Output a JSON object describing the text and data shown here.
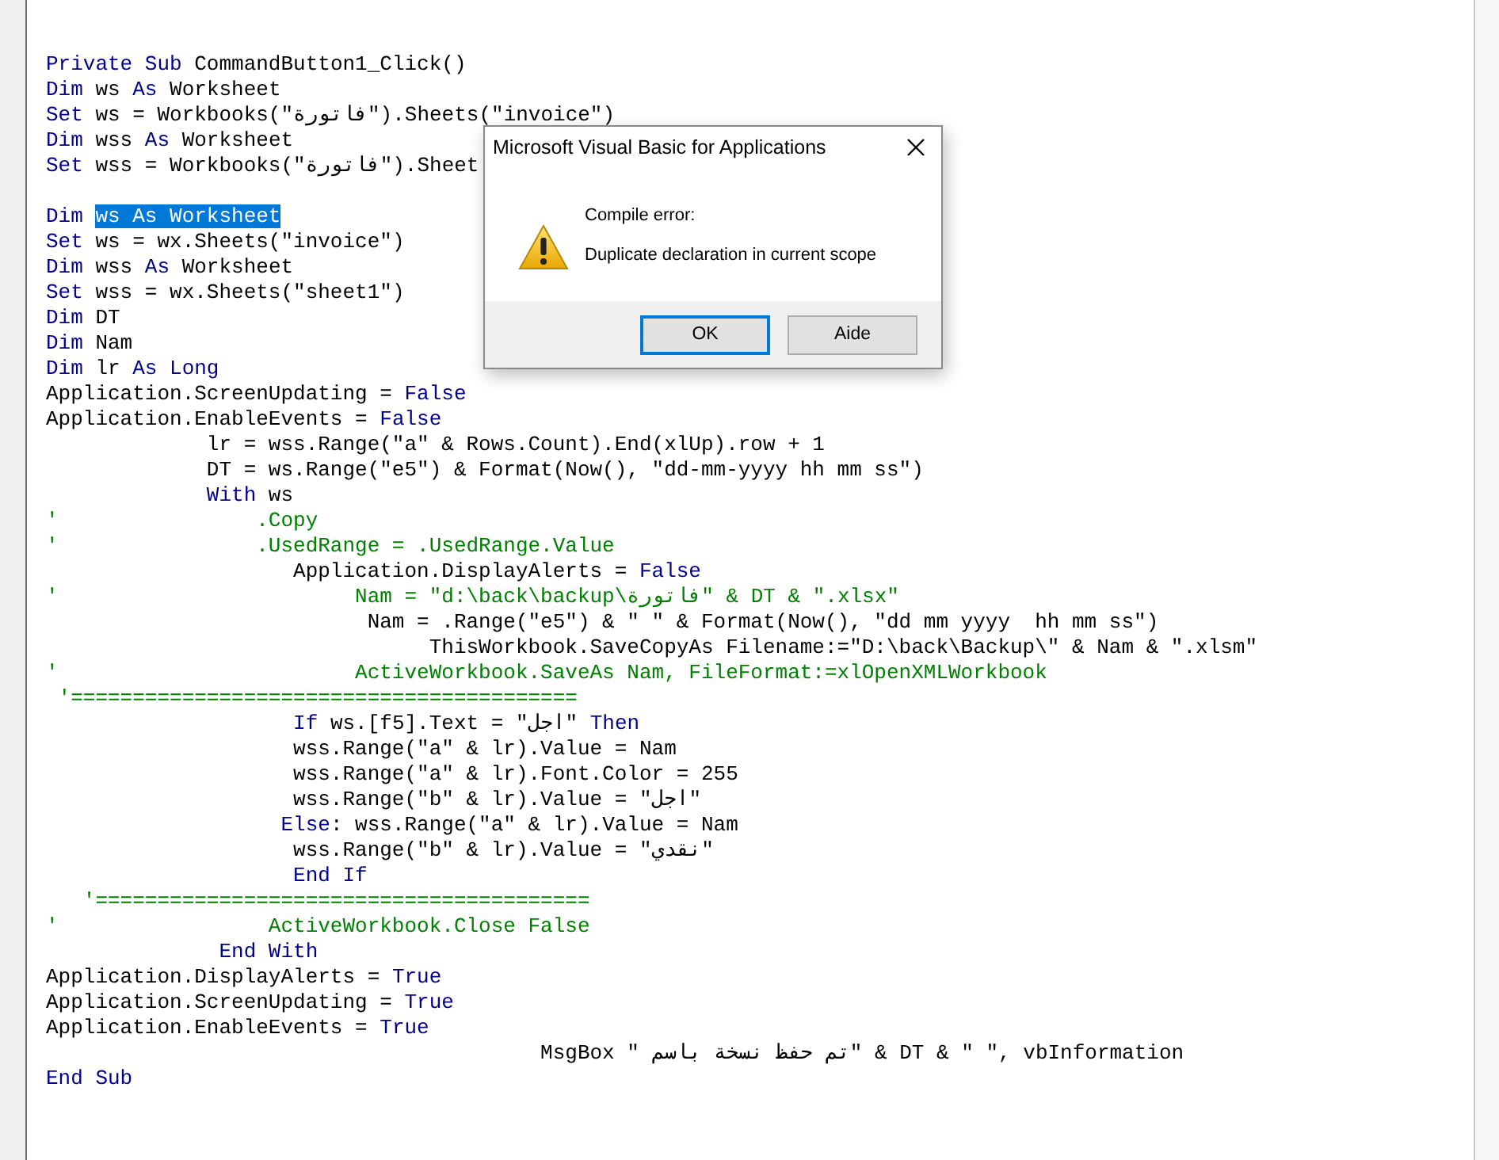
{
  "editor": {
    "lines": [
      {
        "kind": "code",
        "tokens": [
          {
            "kind": "keyword",
            "text": "Private Sub"
          },
          {
            "kind": "plain",
            "text": " CommandButton1_Click()"
          }
        ]
      },
      {
        "kind": "code",
        "tokens": [
          {
            "kind": "keyword",
            "text": "Dim"
          },
          {
            "kind": "plain",
            "text": " ws "
          },
          {
            "kind": "keyword",
            "text": "As"
          },
          {
            "kind": "plain",
            "text": " Worksheet"
          }
        ]
      },
      {
        "kind": "code",
        "tokens": [
          {
            "kind": "keyword",
            "text": "Set"
          },
          {
            "kind": "plain",
            "text": " ws = Workbooks(\"فاتورة\").Sheets(\"invoice\")"
          }
        ]
      },
      {
        "kind": "code",
        "tokens": [
          {
            "kind": "keyword",
            "text": "Dim"
          },
          {
            "kind": "plain",
            "text": " wss "
          },
          {
            "kind": "keyword",
            "text": "As"
          },
          {
            "kind": "plain",
            "text": " Worksheet"
          }
        ]
      },
      {
        "kind": "code",
        "tokens": [
          {
            "kind": "keyword",
            "text": "Set"
          },
          {
            "kind": "plain",
            "text": " wss = Workbooks(\"فاتورة\").Sheet"
          }
        ]
      },
      {
        "kind": "blank"
      },
      {
        "kind": "code",
        "tokens": [
          {
            "kind": "keyword",
            "text": "Dim "
          },
          {
            "kind": "selection",
            "text": "ws As Worksheet"
          }
        ]
      },
      {
        "kind": "code",
        "tokens": [
          {
            "kind": "keyword",
            "text": "Set"
          },
          {
            "kind": "plain",
            "text": " ws = wx.Sheets(\"invoice\")"
          }
        ]
      },
      {
        "kind": "code",
        "tokens": [
          {
            "kind": "keyword",
            "text": "Dim"
          },
          {
            "kind": "plain",
            "text": " wss "
          },
          {
            "kind": "keyword",
            "text": "As"
          },
          {
            "kind": "plain",
            "text": " Worksheet"
          }
        ]
      },
      {
        "kind": "code",
        "tokens": [
          {
            "kind": "keyword",
            "text": "Set"
          },
          {
            "kind": "plain",
            "text": " wss = wx.Sheets(\"sheet1\")"
          }
        ]
      },
      {
        "kind": "code",
        "tokens": [
          {
            "kind": "keyword",
            "text": "Dim"
          },
          {
            "kind": "plain",
            "text": " DT"
          }
        ]
      },
      {
        "kind": "code",
        "tokens": [
          {
            "kind": "keyword",
            "text": "Dim"
          },
          {
            "kind": "plain",
            "text": " Nam"
          }
        ]
      },
      {
        "kind": "code",
        "tokens": [
          {
            "kind": "keyword",
            "text": "Dim"
          },
          {
            "kind": "plain",
            "text": " lr "
          },
          {
            "kind": "keyword",
            "text": "As Long"
          }
        ]
      },
      {
        "kind": "code",
        "tokens": [
          {
            "kind": "plain",
            "text": "Application.ScreenUpdating = "
          },
          {
            "kind": "keyword",
            "text": "False"
          }
        ]
      },
      {
        "kind": "code",
        "tokens": [
          {
            "kind": "plain",
            "text": "Application.EnableEvents = "
          },
          {
            "kind": "keyword",
            "text": "False"
          }
        ]
      },
      {
        "kind": "code",
        "tokens": [
          {
            "kind": "plain",
            "text": "             lr = wss.Range(\"a\" & Rows.Count).End(xlUp).row + 1"
          }
        ]
      },
      {
        "kind": "code",
        "tokens": [
          {
            "kind": "plain",
            "text": "             DT = ws.Range(\"e5\") & Format(Now(), \"dd-mm-yyyy hh mm ss\")"
          }
        ]
      },
      {
        "kind": "code",
        "tokens": [
          {
            "kind": "keyword",
            "text": "             With"
          },
          {
            "kind": "plain",
            "text": " ws"
          }
        ]
      },
      {
        "kind": "code",
        "tokens": [
          {
            "kind": "comment",
            "text": "'                .Copy"
          }
        ]
      },
      {
        "kind": "code",
        "tokens": [
          {
            "kind": "comment",
            "text": "'                .UsedRange = .UsedRange.Value"
          }
        ]
      },
      {
        "kind": "code",
        "tokens": [
          {
            "kind": "plain",
            "text": "                    Application.DisplayAlerts = "
          },
          {
            "kind": "keyword",
            "text": "False"
          }
        ]
      },
      {
        "kind": "code",
        "tokens": [
          {
            "kind": "comment",
            "text": "'                        Nam = \"d:\\back\\backup\\فاتورة\" & DT & \".xlsx\""
          }
        ]
      },
      {
        "kind": "code",
        "tokens": [
          {
            "kind": "plain",
            "text": "                          Nam = .Range(\"e5\") & \" \" & Format(Now(), \"dd mm yyyy  hh mm ss\")"
          }
        ]
      },
      {
        "kind": "code",
        "tokens": [
          {
            "kind": "plain",
            "text": "                               ThisWorkbook.SaveCopyAs Filename:=\"D:\\back\\Backup\\\" & Nam & \".xlsm\""
          }
        ]
      },
      {
        "kind": "code",
        "tokens": [
          {
            "kind": "comment",
            "text": "'                        ActiveWorkbook.SaveAs Nam, FileFormat:=xlOpenXMLWorkbook"
          }
        ]
      },
      {
        "kind": "code",
        "tokens": [
          {
            "kind": "comment",
            "text": " '========================================="
          }
        ]
      },
      {
        "kind": "code",
        "tokens": [
          {
            "kind": "keyword",
            "text": "                    If"
          },
          {
            "kind": "plain",
            "text": " ws.[f5].Text = \"اجل\" "
          },
          {
            "kind": "keyword",
            "text": "Then"
          }
        ]
      },
      {
        "kind": "code",
        "tokens": [
          {
            "kind": "plain",
            "text": "                    wss.Range(\"a\" & lr).Value = Nam"
          }
        ]
      },
      {
        "kind": "code",
        "tokens": [
          {
            "kind": "plain",
            "text": "                    wss.Range(\"a\" & lr).Font.Color = 255"
          }
        ]
      },
      {
        "kind": "code",
        "tokens": [
          {
            "kind": "plain",
            "text": "                    wss.Range(\"b\" & lr).Value = \"اجل\""
          }
        ]
      },
      {
        "kind": "code",
        "tokens": [
          {
            "kind": "keyword",
            "text": "                   Else"
          },
          {
            "kind": "plain",
            "text": ": wss.Range(\"a\" & lr).Value = Nam"
          }
        ]
      },
      {
        "kind": "code",
        "tokens": [
          {
            "kind": "plain",
            "text": "                    wss.Range(\"b\" & lr).Value = \"نقدي\""
          }
        ]
      },
      {
        "kind": "code",
        "tokens": [
          {
            "kind": "keyword",
            "text": "                    End If"
          }
        ]
      },
      {
        "kind": "code",
        "tokens": [
          {
            "kind": "comment",
            "text": "   '========================================"
          }
        ]
      },
      {
        "kind": "code",
        "tokens": [
          {
            "kind": "comment",
            "text": "'                 ActiveWorkbook.Close False"
          }
        ]
      },
      {
        "kind": "code",
        "tokens": [
          {
            "kind": "keyword",
            "text": "              End With"
          }
        ]
      },
      {
        "kind": "code",
        "tokens": [
          {
            "kind": "plain",
            "text": "Application.DisplayAlerts = "
          },
          {
            "kind": "keyword",
            "text": "True"
          }
        ]
      },
      {
        "kind": "code",
        "tokens": [
          {
            "kind": "plain",
            "text": "Application.ScreenUpdating = "
          },
          {
            "kind": "keyword",
            "text": "True"
          }
        ]
      },
      {
        "kind": "code",
        "tokens": [
          {
            "kind": "plain",
            "text": "Application.EnableEvents = "
          },
          {
            "kind": "keyword",
            "text": "True"
          }
        ]
      },
      {
        "kind": "code",
        "tokens": [
          {
            "kind": "plain",
            "text": "                                        MsgBox \" تم حفظ نسخة باسم\" & DT & \" \", vbInformation"
          }
        ]
      },
      {
        "kind": "code",
        "tokens": [
          {
            "kind": "keyword",
            "text": "End Sub"
          }
        ]
      }
    ]
  },
  "dialog": {
    "title": "Microsoft Visual Basic for Applications",
    "heading": "Compile error:",
    "message": "Duplicate declaration in current scope",
    "buttons": [
      {
        "label": "OK",
        "default": true
      },
      {
        "label": "Aide",
        "default": false
      }
    ]
  }
}
